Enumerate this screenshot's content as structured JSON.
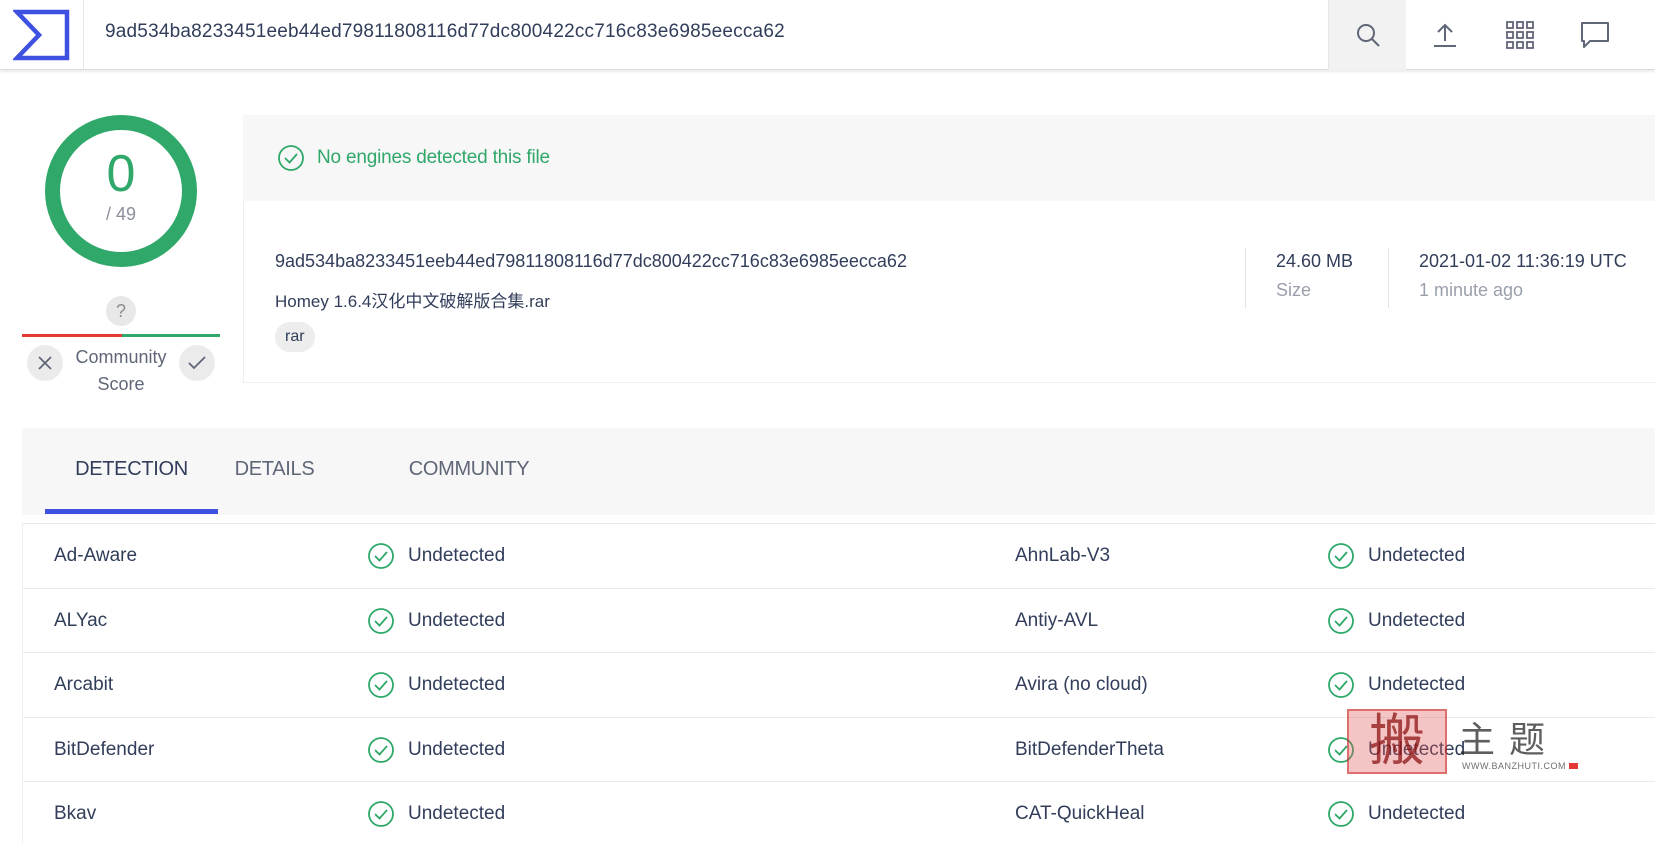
{
  "topbar": {
    "search_value": "9ad534ba8233451eeb44ed79811808116d77dc800422cc716c83e6985eecca62",
    "icons": [
      "virustotal-logo",
      "search-icon",
      "upload-icon",
      "grid-icon",
      "chat-icon"
    ]
  },
  "score": {
    "detections": "0",
    "total": "/ 49",
    "community_q": "?",
    "community_label_1": "Community",
    "community_label_2": "Score"
  },
  "summary": {
    "banner": "No engines detected this file",
    "hash": "9ad534ba8233451eeb44ed79811808116d77dc800422cc716c83e6985eecca62",
    "filename": "Homey 1.6.4汉化中文破解版合集.rar",
    "tag": "rar",
    "size_value": "24.60 MB",
    "size_label": "Size",
    "date_value": "2021-01-02 11:36:19 UTC",
    "date_label": "1 minute ago"
  },
  "tabs": [
    {
      "label": "DETECTION",
      "active": true
    },
    {
      "label": "DETAILS",
      "active": false
    },
    {
      "label": "COMMUNITY",
      "active": false
    }
  ],
  "detections": [
    {
      "engine_a": "Ad-Aware",
      "status_a": "Undetected",
      "engine_b": "AhnLab-V3",
      "status_b": "Undetected"
    },
    {
      "engine_a": "ALYac",
      "status_a": "Undetected",
      "engine_b": "Antiy-AVL",
      "status_b": "Undetected"
    },
    {
      "engine_a": "Arcabit",
      "status_a": "Undetected",
      "engine_b": "Avira (no cloud)",
      "status_b": "Undetected"
    },
    {
      "engine_a": "BitDefender",
      "status_a": "Undetected",
      "engine_b": "BitDefenderTheta",
      "status_b": "Undetected"
    },
    {
      "engine_a": "Bkav",
      "status_a": "Undetected",
      "engine_b": "CAT-QuickHeal",
      "status_b": "Undetected"
    }
  ],
  "watermark": {
    "stamp": "搬",
    "text": "主题",
    "url": "WWW.BANZHUTI.COM"
  },
  "colors": {
    "clean_green": "#2fa86a",
    "accent_blue": "#3f51e0",
    "text_dark": "#313d5a",
    "negative_red": "#e53935"
  }
}
